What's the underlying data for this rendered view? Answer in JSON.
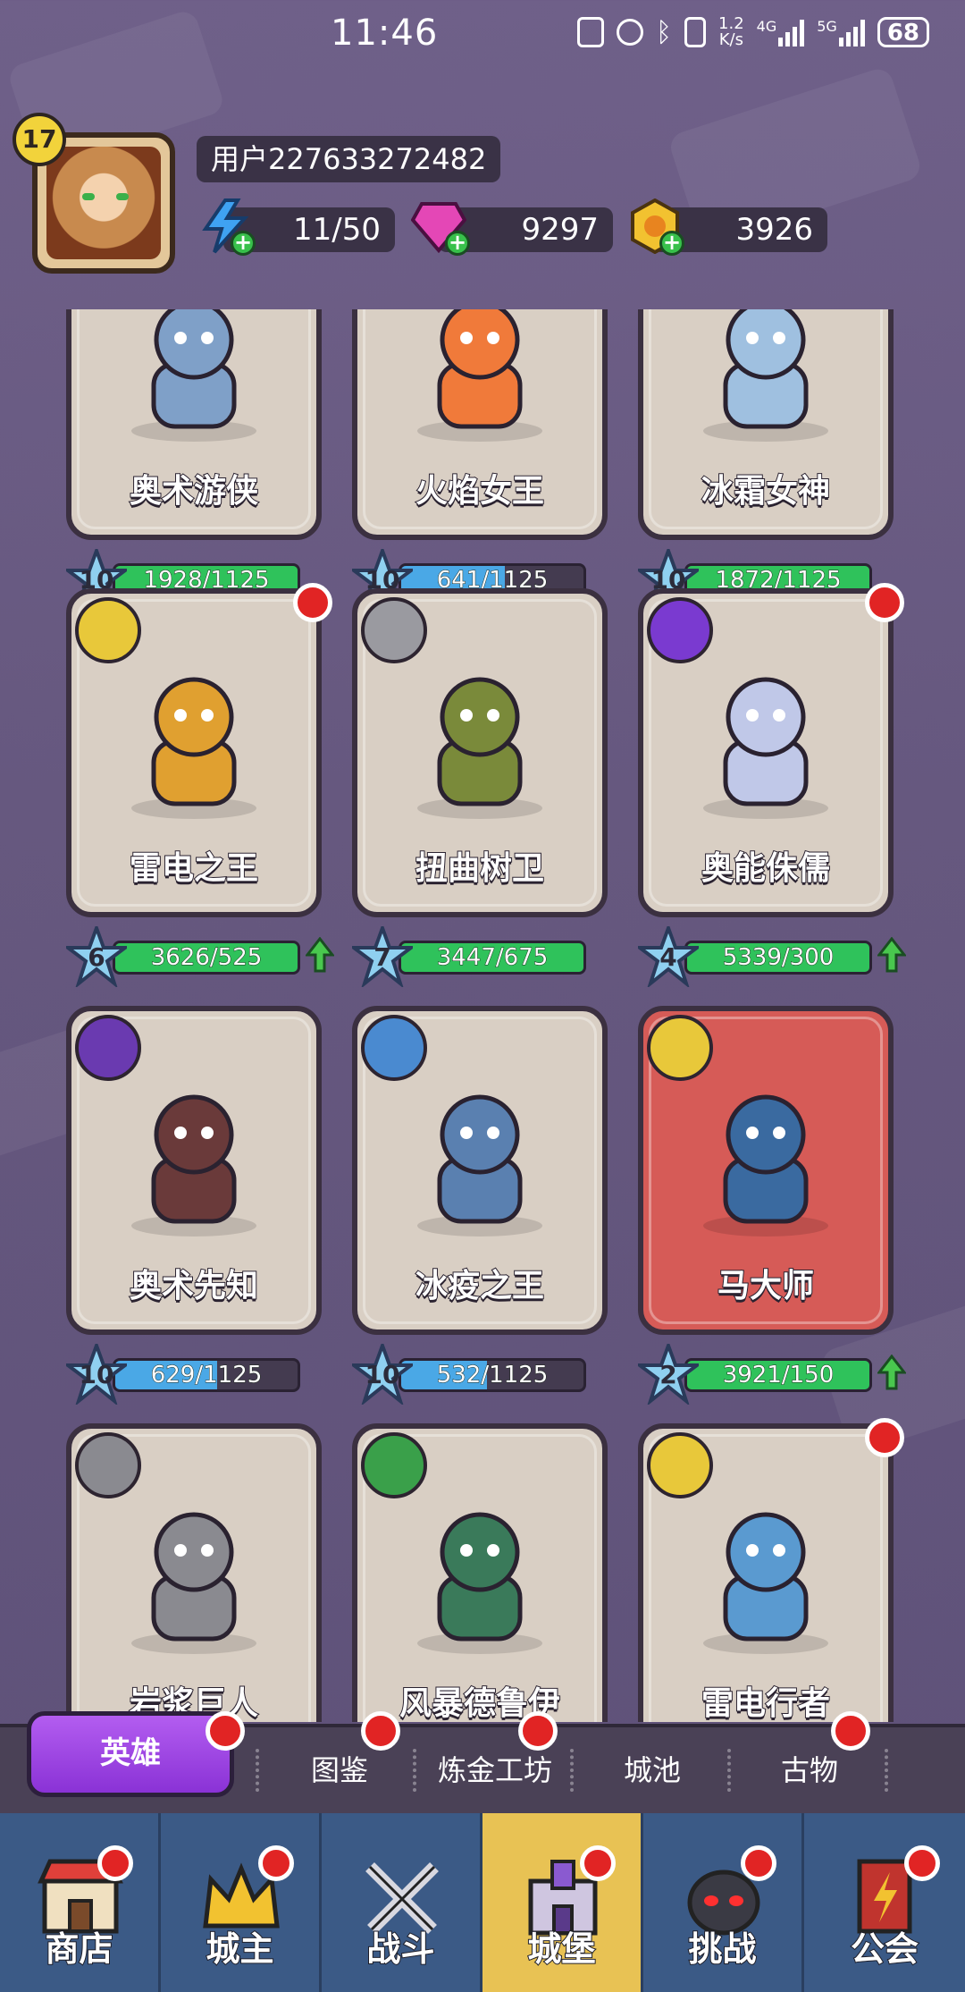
{
  "status_bar": {
    "time": "11:46",
    "speed_value": "1.2",
    "speed_unit": "K/s",
    "net1": "4G",
    "net2": "5G",
    "battery": "68"
  },
  "profile": {
    "level": "17",
    "username": "用户227633272482",
    "energy": "11/50",
    "gems": "9297",
    "gold": "3926"
  },
  "heroes": [
    {
      "name": "奥术游侠",
      "stars": "10",
      "progress": "1928/1125",
      "fill_ratio": 1.0,
      "bar_color": "#2fc25b",
      "upgrade": false,
      "notify": false
    },
    {
      "name": "火焰女王",
      "stars": "10",
      "progress": "641/1125",
      "fill_ratio": 0.57,
      "bar_color": "#4aa8e6",
      "upgrade": false,
      "notify": false
    },
    {
      "name": "冰霜女神",
      "stars": "10",
      "progress": "1872/1125",
      "fill_ratio": 1.0,
      "bar_color": "#2fc25b",
      "upgrade": false,
      "notify": false
    },
    {
      "name": "雷电之王",
      "stars": "6",
      "progress": "3626/525",
      "fill_ratio": 1.0,
      "bar_color": "#2fc25b",
      "upgrade": true,
      "notify": true,
      "element": "lightning-element-icon"
    },
    {
      "name": "扭曲树卫",
      "stars": "7",
      "progress": "3447/675",
      "fill_ratio": 1.0,
      "bar_color": "#2fc25b",
      "upgrade": false,
      "notify": false,
      "element": "iron-element-icon"
    },
    {
      "name": "奥能侏儒",
      "stars": "4",
      "progress": "5339/300",
      "fill_ratio": 1.0,
      "bar_color": "#2fc25b",
      "upgrade": true,
      "notify": true,
      "element": "arcane-element-icon"
    },
    {
      "name": "奥术先知",
      "stars": "10",
      "progress": "629/1125",
      "fill_ratio": 0.56,
      "bar_color": "#4aa8e6",
      "upgrade": false,
      "notify": false,
      "element": "arcane-staff-element-icon"
    },
    {
      "name": "冰疫之王",
      "stars": "10",
      "progress": "532/1125",
      "fill_ratio": 0.47,
      "bar_color": "#4aa8e6",
      "upgrade": false,
      "notify": false,
      "element": "ice-element-icon"
    },
    {
      "name": "马大师",
      "stars": "2",
      "progress": "3921/150",
      "fill_ratio": 1.0,
      "bar_color": "#2fc25b",
      "upgrade": true,
      "notify": false,
      "element": "lightning-element-icon",
      "red": true
    },
    {
      "name": "岩浆巨人",
      "notify": false,
      "element": "rock-element-icon"
    },
    {
      "name": "风暴德鲁伊",
      "notify": false,
      "element": "wind-element-icon"
    },
    {
      "name": "雷电行者",
      "notify": true,
      "element": "lightning-element-icon"
    }
  ],
  "sub_tabs": [
    "英雄",
    "图鉴",
    "炼金工坊",
    "城池",
    "古物"
  ],
  "nav": [
    "商店",
    "城主",
    "战斗",
    "城堡",
    "挑战",
    "公会"
  ],
  "colors": {
    "background": "#6a5c86",
    "card": "#d9cfc4",
    "card_highlight": "#d65b57",
    "bar_full": "#2fc25b",
    "bar_partial": "#4aa8e6",
    "notify_dot": "#e12424",
    "tab_active": "#9d45e3",
    "nav_bg": "#3b5a86",
    "nav_active": "#e8c254"
  }
}
